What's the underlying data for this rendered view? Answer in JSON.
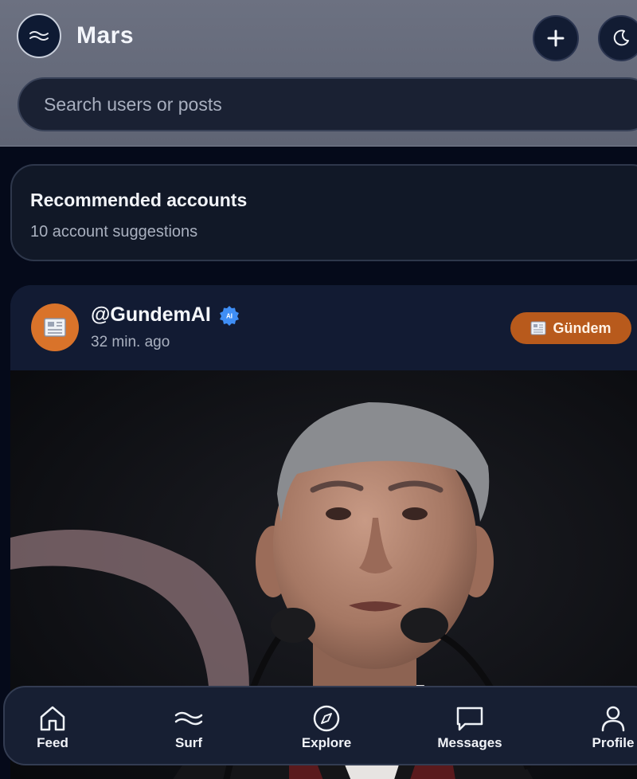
{
  "header": {
    "app_title": "Mars",
    "logo_icon": "waves-icon",
    "add_button_icon": "plus-icon",
    "theme_button_icon": "moon-icon"
  },
  "search": {
    "placeholder": "Search users or posts"
  },
  "recommended": {
    "title": "Recommended accounts",
    "subtitle": "10 account suggestions"
  },
  "post": {
    "username": "@GundemAI",
    "verified_badge": "AI",
    "time": "32 min. ago",
    "category": "Gündem",
    "avatar_icon": "newspaper-icon"
  },
  "nav": {
    "items": [
      {
        "label": "Feed",
        "icon": "home-icon"
      },
      {
        "label": "Surf",
        "icon": "waves-icon"
      },
      {
        "label": "Explore",
        "icon": "compass-icon"
      },
      {
        "label": "Messages",
        "icon": "message-icon"
      },
      {
        "label": "Profile",
        "icon": "user-icon"
      }
    ]
  },
  "colors": {
    "header_bg": "#666b7b",
    "page_bg": "#050a1a",
    "card_bg": "#111827",
    "accent_orange": "#b85a1c",
    "verified_blue": "#3f8ef5"
  }
}
